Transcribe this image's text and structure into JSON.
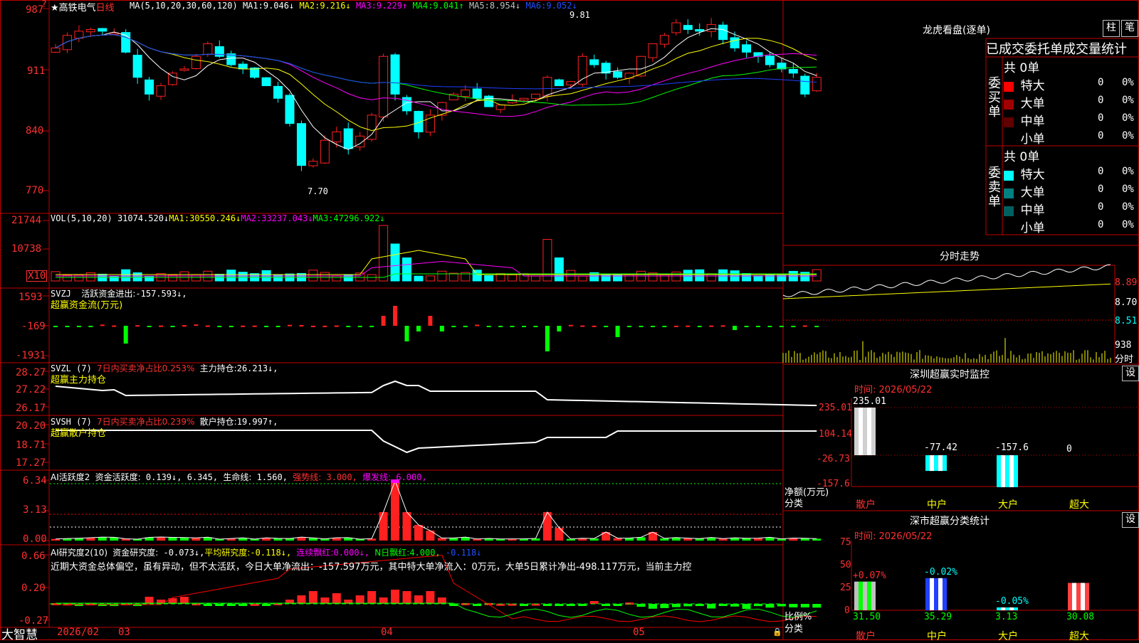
{
  "colors": {
    "up": "#ff2020",
    "down": "#00ffff",
    "bg": "#000000",
    "border": "#c00000",
    "ma1": "#ffffff",
    "ma2": "#ffff00",
    "ma3": "#ff00ff",
    "ma4": "#00ff00",
    "ma5": "#c0c0c0",
    "ma6": "#2040ff"
  },
  "stock": {
    "star": "★",
    "name": "高铁电气",
    "period": "日线"
  },
  "ma_legend": {
    "label": "MA(5,10,20,30,60,120)",
    "items": [
      {
        "name": "MA1:",
        "value": "9.046↓",
        "color": "#ffffff"
      },
      {
        "name": "MA2:",
        "value": "9.216↓",
        "color": "#ffff00"
      },
      {
        "name": "MA3:",
        "value": "9.229↑",
        "color": "#ff00ff"
      },
      {
        "name": "MA4:",
        "value": "9.041↑",
        "color": "#00ff00"
      },
      {
        "name": "MA5:",
        "value": "8.954↓",
        "color": "#c0c0c0"
      },
      {
        "name": "MA6:",
        "value": "9.052↓",
        "color": "#2050ff"
      }
    ]
  },
  "price_axis": [
    "987",
    "911",
    "840",
    "770"
  ],
  "price_marks": {
    "high": "9.81",
    "low": "7.70"
  },
  "vol_legend": {
    "label": "VOL(5,10,20)",
    "value": "31074.520↓",
    "items": [
      {
        "name": "MA1:",
        "value": "30550.246↓",
        "color": "#ffff00"
      },
      {
        "name": "MA2:",
        "value": "33237.043↓",
        "color": "#ff00ff"
      },
      {
        "name": "MA3:",
        "value": "47296.922↓",
        "color": "#00ff00"
      }
    ]
  },
  "vol_axis": [
    "21744",
    "10738"
  ],
  "vol_unit": "X10",
  "svzj": {
    "label": "SVZJ",
    "title": "活跃资金进出:",
    "value": "-157.593↓,",
    "sub": "超赢资金流(万元)",
    "axis": [
      "1593",
      "-169",
      "-1931"
    ]
  },
  "svzl": {
    "label": "SVZL (7)",
    "pct": "7日内买卖净占比0.253%",
    "hold_label": "主力持仓:",
    "hold": "26.213↓,",
    "sub": "超赢主力持仓",
    "axis": [
      "28.27",
      "27.22",
      "26.17"
    ]
  },
  "svsh": {
    "label": "SVSH (7)",
    "pct": "7日内买卖净占比0.239%",
    "hold_label": "散户持仓:",
    "hold": "19.997↑,",
    "sub": "超赢散户持仓",
    "axis": [
      "20.20",
      "18.71",
      "17.27"
    ]
  },
  "ai1": {
    "label": "AI活跃度2",
    "t1": "资金活跃度:",
    "v1": "0.139↓,",
    "v2": "6.345,",
    "t3": "生命线:",
    "v3": "1.560,",
    "t4": "强势线:",
    "v4": "3.000,",
    "t5": "爆发线:",
    "v5": "6.000,",
    "axis": [
      "6.34",
      "3.13",
      "0.00"
    ]
  },
  "ai2": {
    "label": "AI研究度2(10)",
    "t1": "资金研究度:",
    "v1": "-0.073↓,",
    "t2": "平均研究度:",
    "v2": "-0.118↓,",
    "t3": "连续飘红:",
    "v3": "0.000↓,",
    "t4": "N日飘红:",
    "v4": "4.000,",
    "v5": "-0.118↓",
    "axis": [
      "0.66",
      "0.20",
      "-0.27"
    ],
    "note": "近期大资金总体偏空，虽有异动，但不太活跃，今日大单净流出：-157.597万元，其中特大单净流入：0万元，大单5日累计净出-498.117万元，当前主力控"
  },
  "date_axis": {
    "brand": "大智慧",
    "labels": [
      "2026/02",
      "03",
      "04",
      "05"
    ]
  },
  "dragon": {
    "title": "龙虎看盘(逐单)",
    "btn1": "柱",
    "btn2": "笔",
    "header": "已成交委托单成交量统计",
    "buy": {
      "side": "委买单",
      "total": "共 0单",
      "rows": [
        {
          "label": "特大",
          "color": "#ff0000",
          "n": "0",
          "pct": "0%"
        },
        {
          "label": "大单",
          "color": "#a00000",
          "n": "0",
          "pct": "0%"
        },
        {
          "label": "中单",
          "color": "#600000",
          "n": "0",
          "pct": "0%"
        },
        {
          "label": "小单",
          "color": "#000000",
          "n": "0",
          "pct": "0%"
        }
      ]
    },
    "sell": {
      "side": "委卖单",
      "total": "共 0单",
      "rows": [
        {
          "label": "特大",
          "color": "#00ffff",
          "n": "0",
          "pct": "0%"
        },
        {
          "label": "大单",
          "color": "#008080",
          "n": "0",
          "pct": "0%"
        },
        {
          "label": "中单",
          "color": "#006060",
          "n": "0",
          "pct": "0%"
        },
        {
          "label": "小单",
          "color": "#000000",
          "n": "0",
          "pct": "0%"
        }
      ]
    }
  },
  "intraday": {
    "title": "分时走势",
    "axis": [
      "8.89",
      "8.70",
      "8.51",
      "938"
    ],
    "vol_unit": "分时"
  },
  "sz_monitor": {
    "title": "深圳超赢实时监控",
    "btn": "设",
    "time": "时间: 2026/05/22",
    "axis": [
      "235.01",
      "104.14",
      "-26.73",
      "-157.6"
    ],
    "unit": "净额(万元)",
    "cat_label": "分类",
    "chart_data": {
      "type": "bar",
      "categories": [
        "散户",
        "中户",
        "大户",
        "超大"
      ],
      "values": [
        235.01,
        -77.42,
        -157.6,
        0
      ],
      "value_labels": [
        "235.01",
        "-77.42",
        "-157.6",
        "0"
      ],
      "ylim": [
        -157.6,
        235.01
      ]
    }
  },
  "sz_class": {
    "title": "深市超赢分类统计",
    "btn": "设",
    "time": "时间: 2026/05/22",
    "axis": [
      "75",
      "50",
      "25",
      "0"
    ],
    "unit": "比例%",
    "cat_label": "分类",
    "chart_data": {
      "type": "bar",
      "categories": [
        "散户",
        "中户",
        "大户",
        "超大"
      ],
      "values": [
        31.5,
        35.29,
        3.13,
        30.08
      ],
      "changes": [
        "+0.07%",
        "-0.02%",
        "-0.05%",
        ""
      ],
      "value_labels": [
        "31.50",
        "35.29",
        "3.13",
        "30.08"
      ],
      "ylim": [
        0,
        75
      ]
    }
  }
}
